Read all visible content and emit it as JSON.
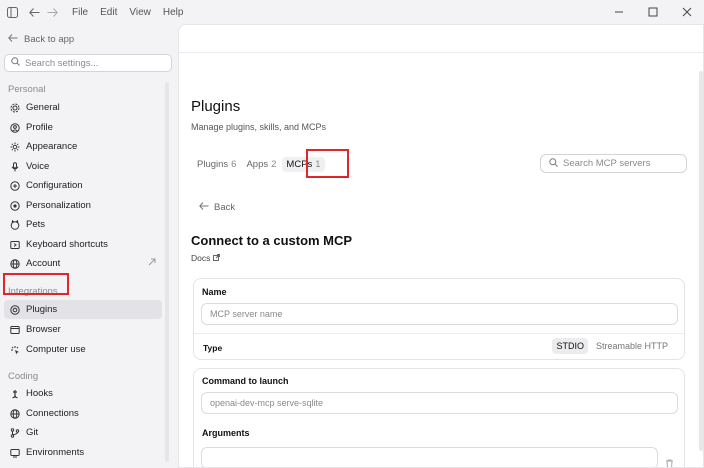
{
  "titlebar": {
    "menus": [
      "File",
      "Edit",
      "View",
      "Help"
    ]
  },
  "sidebar": {
    "back_label": "Back to app",
    "search_placeholder": "Search settings...",
    "sections": {
      "personal": "Personal",
      "integrations": "Integrations",
      "coding": "Coding"
    },
    "items": {
      "general": "General",
      "profile": "Profile",
      "appearance": "Appearance",
      "voice": "Voice",
      "configuration": "Configuration",
      "personalization": "Personalization",
      "pets": "Pets",
      "keyboard_shortcuts": "Keyboard shortcuts",
      "account": "Account",
      "plugins": "Plugins",
      "browser": "Browser",
      "computer_use": "Computer use",
      "hooks": "Hooks",
      "connections": "Connections",
      "git": "Git",
      "environments": "Environments"
    },
    "active_item": "plugins"
  },
  "main": {
    "title": "Plugins",
    "subtitle": "Manage plugins, skills, and MCPs",
    "tabs": [
      {
        "label": "Plugins",
        "count": "6"
      },
      {
        "label": "Apps",
        "count": "2"
      },
      {
        "label": "MCPs",
        "count": "1"
      }
    ],
    "active_tab": "MCPs",
    "search_placeholder": "Search MCP servers",
    "back_label": "Back",
    "heading": "Connect to a custom MCP",
    "docs_label": "Docs",
    "form": {
      "name_label": "Name",
      "name_placeholder": "MCP server name",
      "type_label": "Type",
      "type_options": [
        "STDIO",
        "Streamable HTTP"
      ],
      "type_selected": "STDIO",
      "command_label": "Command to launch",
      "command_placeholder": "openai-dev-mcp serve-sqlite",
      "arguments_label": "Arguments",
      "argument_value": ""
    }
  },
  "colors": {
    "highlight": "#e0262b",
    "active_bg": "#e3e3e7"
  }
}
